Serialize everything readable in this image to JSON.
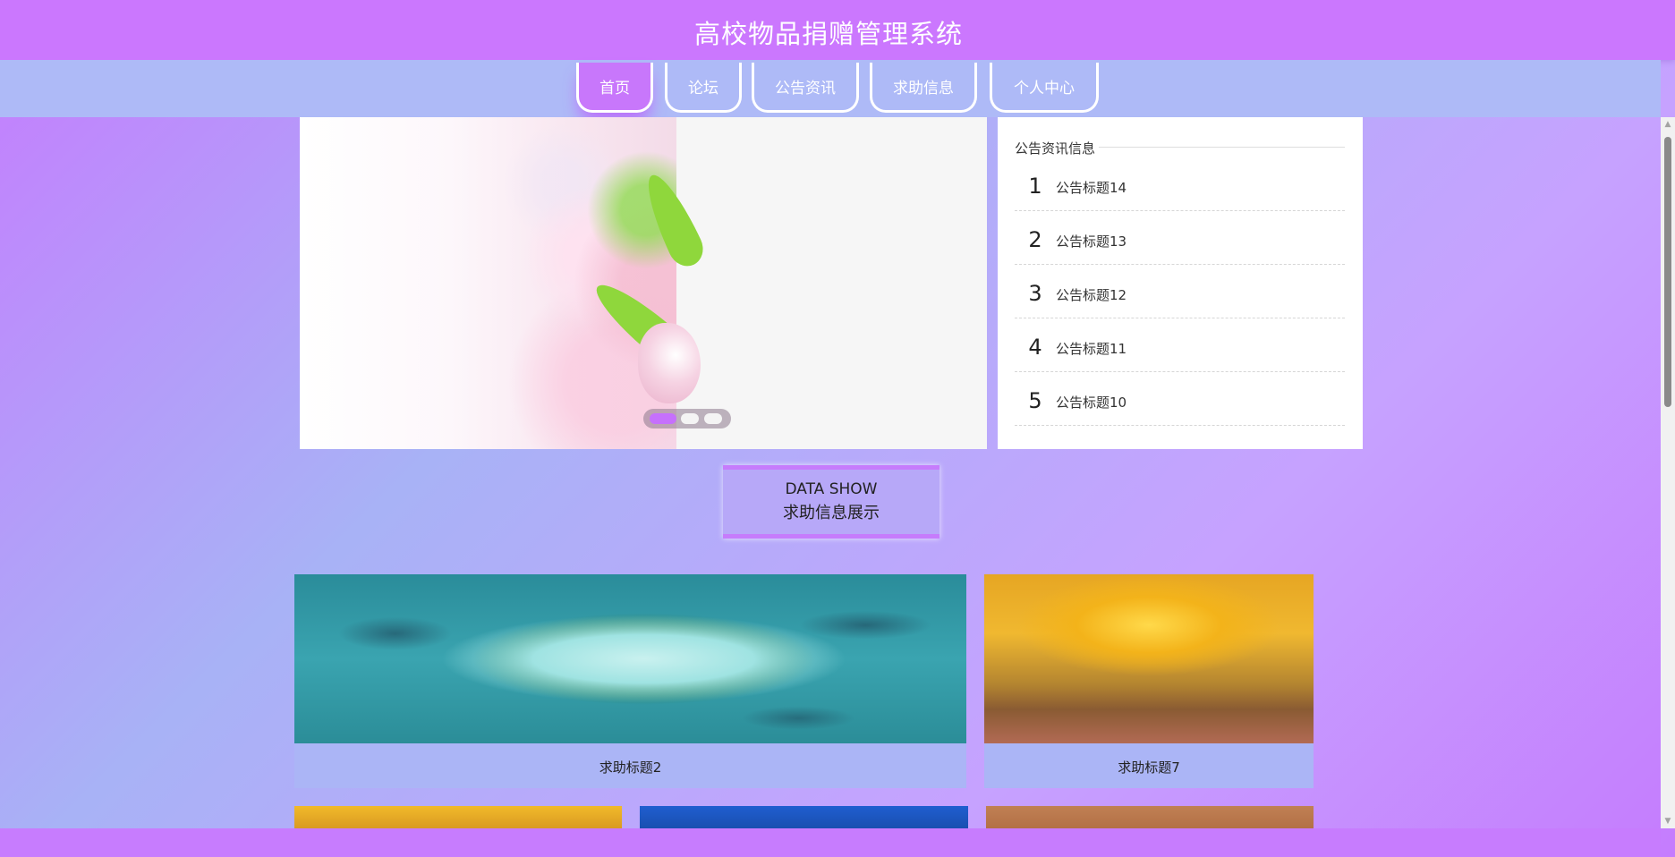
{
  "header": {
    "title": "高校物品捐赠管理系统"
  },
  "nav": {
    "items": [
      {
        "label": "首页",
        "active": true
      },
      {
        "label": "论坛"
      },
      {
        "label": "公告资讯"
      },
      {
        "label": "求助信息"
      },
      {
        "label": "个人中心"
      }
    ]
  },
  "slider": {
    "dot_count": 3,
    "active_dot": 1
  },
  "notice": {
    "title": "公告资讯信息",
    "items": [
      {
        "num": "1",
        "text": "公告标题14"
      },
      {
        "num": "2",
        "text": "公告标题13"
      },
      {
        "num": "3",
        "text": "公告标题12"
      },
      {
        "num": "4",
        "text": "公告标题11"
      },
      {
        "num": "5",
        "text": "公告标题10"
      }
    ]
  },
  "data_show": {
    "en": "DATA SHOW",
    "zh": "求助信息展示"
  },
  "cards": [
    {
      "label": "求助标题2",
      "image": "heart-island"
    },
    {
      "label": "求助标题7",
      "image": "autumn-trees"
    },
    {
      "label": "",
      "image": "autumn-trees"
    },
    {
      "label": "",
      "image": "blue-sky"
    },
    {
      "label": "",
      "image": "desert"
    }
  ],
  "colors": {
    "header": "#cb77fe",
    "nav_band": "#aebaf7",
    "accent": "#c670fc",
    "card_label_bg": "#abb5f6"
  }
}
